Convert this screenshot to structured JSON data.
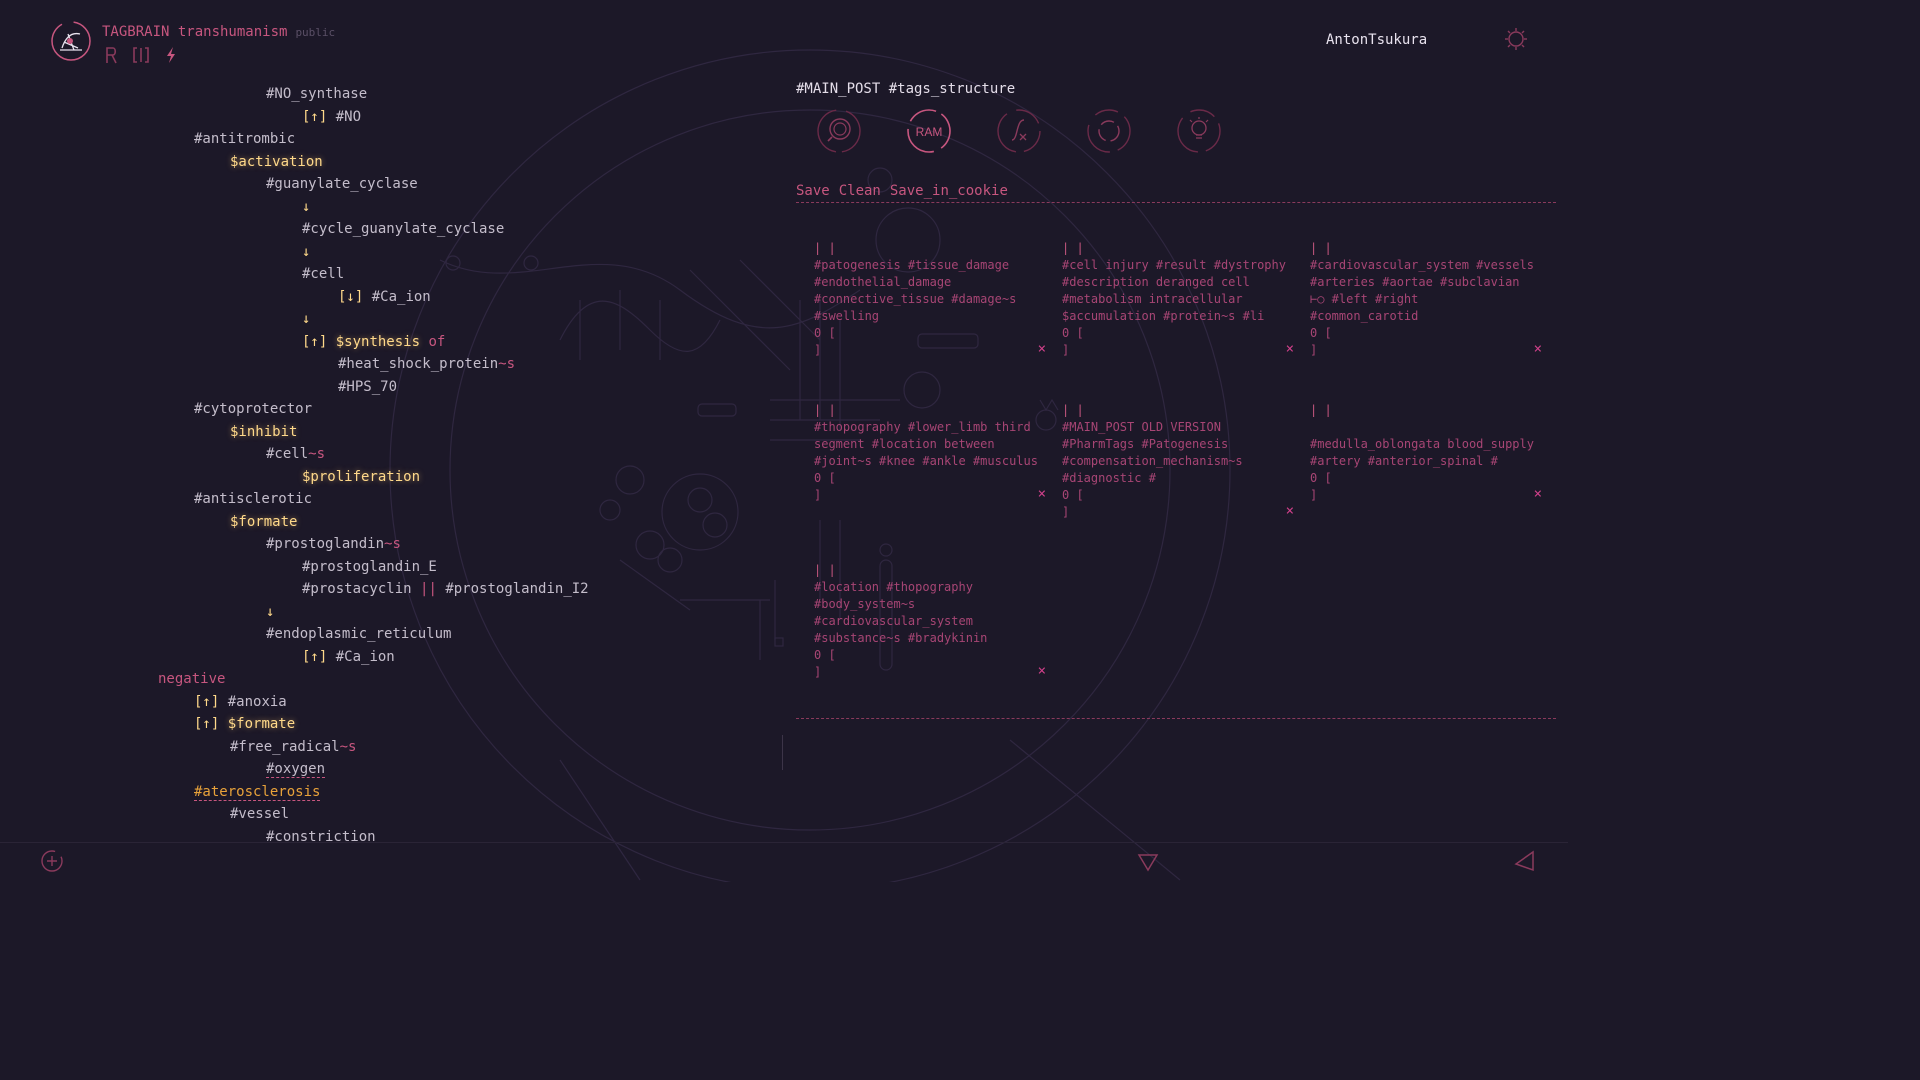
{
  "app": {
    "brand": "TAGBRAIN transhumanism",
    "visibility": "public",
    "user": "AntonTsukura"
  },
  "colors": {
    "bg": "#1c1828",
    "accent_pink": "#c7567f",
    "accent_yellow": "#ffd98a",
    "accent_orange": "#e8a23a",
    "text": "#c4bdcb"
  },
  "tree": [
    {
      "indent": 4,
      "text": "#NO_synthase"
    },
    {
      "indent": 5,
      "prefix": "[↑]",
      "text": "#NO"
    },
    {
      "indent": 2,
      "text": "#antitrombic"
    },
    {
      "indent": 3,
      "var": "$activation"
    },
    {
      "indent": 4,
      "text": "#guanylate_cyclase"
    },
    {
      "indent": 5,
      "arrow": "↓"
    },
    {
      "indent": 5,
      "text": "#cycle_guanylate_cyclase"
    },
    {
      "indent": 5,
      "arrow": "↓"
    },
    {
      "indent": 5,
      "text": "#cell"
    },
    {
      "indent": 6,
      "prefix": "[↓]",
      "text": "#Ca_ion"
    },
    {
      "indent": 5,
      "arrow": "↓"
    },
    {
      "indent": 5,
      "prefix": "[↑]",
      "var": "$synthesis",
      "after": "of"
    },
    {
      "indent": 6,
      "text": "#heat_shock_protein",
      "suffix": "~s"
    },
    {
      "indent": 6,
      "text": "#HPS_70"
    },
    {
      "indent": 2,
      "text": "#cytoprotector"
    },
    {
      "indent": 3,
      "var": "$inhibit"
    },
    {
      "indent": 4,
      "text": "#cell",
      "suffix": "~s"
    },
    {
      "indent": 5,
      "var": "$proliferation"
    },
    {
      "indent": 2,
      "text": "#antisclerotic"
    },
    {
      "indent": 3,
      "var": "$formate"
    },
    {
      "indent": 4,
      "text": "#prostoglandin",
      "suffix": "~s"
    },
    {
      "indent": 5,
      "text": "#prostoglandin_E"
    },
    {
      "indent": 5,
      "text": "#prostacyclin",
      "sep": "||",
      "text2": "#prostoglandin_I2"
    },
    {
      "indent": 4,
      "arrow": "↓"
    },
    {
      "indent": 4,
      "text": "#endoplasmic_reticulum"
    },
    {
      "indent": 5,
      "prefix": "[↑]",
      "text": "#Ca_ion"
    },
    {
      "indent": 1,
      "pink": "negative"
    },
    {
      "indent": 2,
      "prefix": "[↑]",
      "text": "#anoxia"
    },
    {
      "indent": 2,
      "prefix": "[↑]",
      "var": "$formate"
    },
    {
      "indent": 3,
      "text": "#free_radical",
      "suffix": "~s"
    },
    {
      "indent": 4,
      "text": "#oxygen",
      "underline": true
    },
    {
      "indent": 2,
      "orange": "#aterosclerosis",
      "underline": true
    },
    {
      "indent": 3,
      "text": "#vessel"
    },
    {
      "indent": 4,
      "text": "#constriction"
    }
  ],
  "post": {
    "heading": "#MAIN_POST #tags_structure",
    "tools": [
      "search-icon",
      "RAM",
      "function-icon",
      "refresh-icon",
      "lightbulb-icon"
    ],
    "ram_label": "RAM",
    "actions": [
      "Save",
      "Clean",
      "Save_in_cookie"
    ]
  },
  "cards": [
    {
      "pipes": "| |",
      "lines": [
        "#patogenesis #tissue_damage",
        "#endothelial_damage",
        "#connective_tissue #damage~s",
        "#swelling"
      ],
      "count": "0 [",
      "close": "]"
    },
    {
      "pipes": "| |",
      "lines": [
        "#cell injury #result #dystrophy",
        "#description deranged cell",
        "#metabolism intracellular",
        "$accumulation #protein~s #li"
      ],
      "count": "0 [",
      "close": "]"
    },
    {
      "pipes": "| |",
      "lines": [
        "#cardiovascular_system #vessels",
        "#arteries #aortae #subclavian",
        "⊢○ #left #right",
        "#common_carotid"
      ],
      "count": "0 [",
      "close": "]"
    },
    {
      "pipes": "| |",
      "lines": [
        "#thopography #lower_limb third",
        "segment #location between",
        "#joint~s #knee #ankle #musculus"
      ],
      "count": "0 [",
      "close": "]"
    },
    {
      "pipes": "| |",
      "lines": [
        "#MAIN_POST OLD VERSION",
        "#PharmTags #Patogenesis",
        "#compensation_mechanism~s",
        "#diagnostic #"
      ],
      "count": "0 [",
      "close": "]"
    },
    {
      "pipes": "| |",
      "lines": [
        "",
        "#medulla_oblongata blood_supply",
        "#artery #anterior_spinal #"
      ],
      "count": "0 [",
      "close": "]"
    },
    {
      "pipes": "| |",
      "lines": [
        "#location #thopography",
        "#body_system~s",
        "#cardiovascular_system",
        "#substance~s #bradykinin"
      ],
      "count": "0 [",
      "close": "]"
    }
  ],
  "card_close_glyph": "×",
  "footer": {
    "left_icon": "add-circle-icon",
    "center_icon": "triangle-down-icon",
    "right_icon": "back-triangle-icon"
  }
}
